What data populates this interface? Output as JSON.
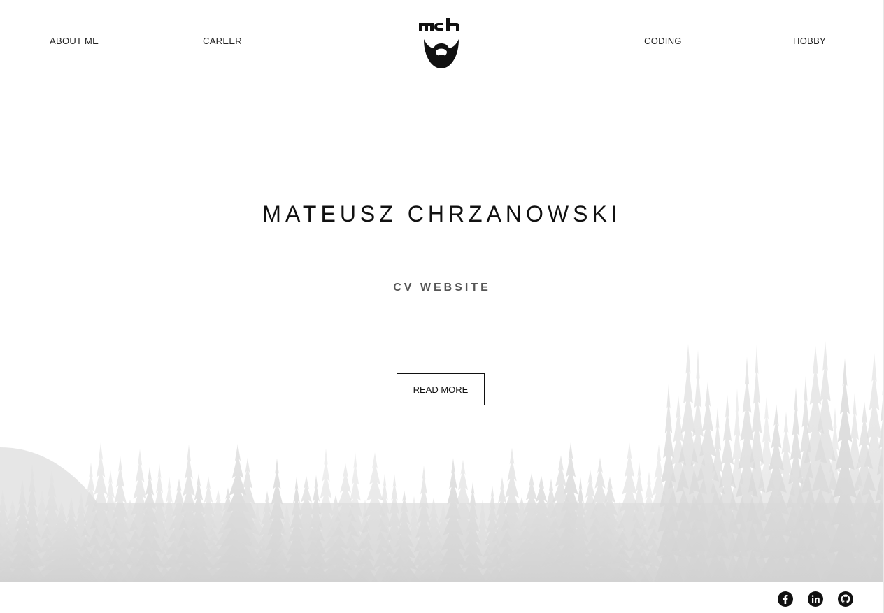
{
  "nav": {
    "left": [
      {
        "label": "ABOUT ME"
      },
      {
        "label": "CAREER"
      }
    ],
    "right": [
      {
        "label": "CODING"
      },
      {
        "label": "HOBBY"
      }
    ],
    "logo_text": "mch"
  },
  "hero": {
    "title": "MATEUSZ CHRZANOWSKI",
    "subtitle": "CV WEBSITE",
    "button_label": "READ MORE"
  },
  "footer": {
    "social_icons": [
      "facebook-icon",
      "linkedin-icon",
      "github-icon"
    ]
  },
  "colors": {
    "text": "#111111",
    "subtitle": "#555555",
    "background": "#ffffff",
    "forest": "#d9d9d9"
  }
}
